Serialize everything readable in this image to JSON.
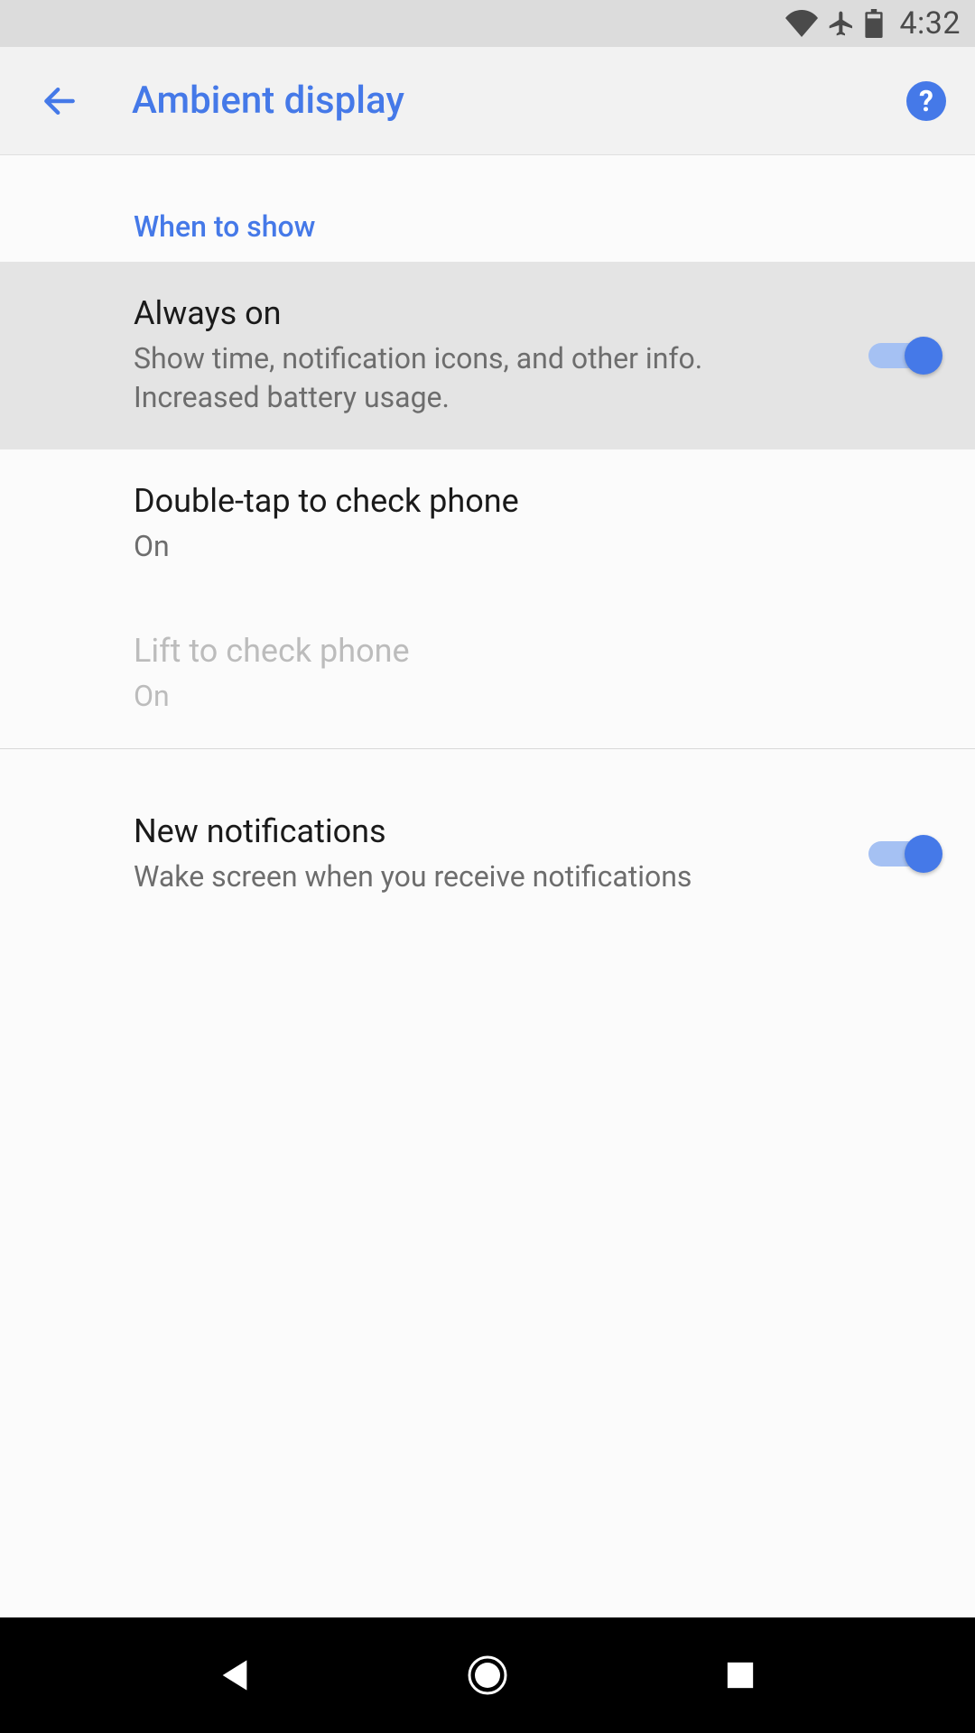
{
  "status": {
    "time": "4:32"
  },
  "header": {
    "title": "Ambient display",
    "help_symbol": "?"
  },
  "section": {
    "title": "When to show"
  },
  "items": {
    "always_on": {
      "title": "Always on",
      "subtitle": "Show time, notification icons, and other info. Increased battery usage.",
      "switch_on": true
    },
    "double_tap": {
      "title": "Double-tap to check phone",
      "subtitle": "On"
    },
    "lift": {
      "title": "Lift to check phone",
      "subtitle": "On",
      "disabled": true
    },
    "notifications": {
      "title": "New notifications",
      "subtitle": "Wake screen when you receive notifications",
      "switch_on": true
    }
  },
  "colors": {
    "accent": "#4579e8",
    "accent_light": "#a5c1f3",
    "highlight": "#e4e4e4"
  }
}
